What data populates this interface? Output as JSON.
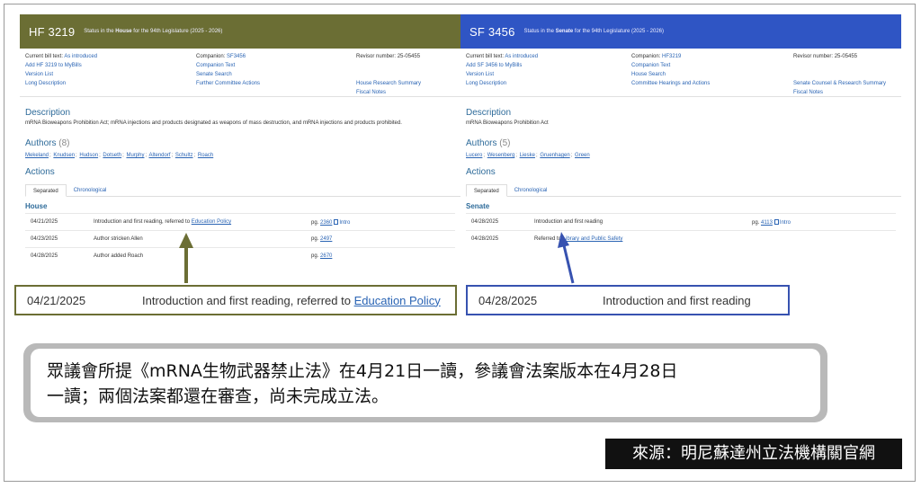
{
  "house": {
    "bill_number": "HF 3219",
    "status_pre": "Status in the ",
    "status_bold": "House",
    "status_post": " for the 94th Legislature (2025 - 2026)",
    "current_bill_text_label": "Current bill text:",
    "current_bill_text": "As introduced",
    "add_mybills": "Add HF 3219 to MyBills",
    "version_list": "Version List",
    "long_description": "Long Description",
    "companion_label": "Companion:",
    "companion": "SF3456",
    "companion_text": "Companion Text",
    "search_link": "Senate Search",
    "committee_link": "Further Committee Actions",
    "revisor_label": "Revisor number:",
    "revisor_number": "25-05455",
    "research_link": "House Research Summary",
    "fiscal_notes": "Fiscal Notes",
    "description_title": "Description",
    "description_text": "mRNA Bioweapons Prohibition Act; mRNA injections and products designated as weapons of mass destruction, and mRNA injections and products prohibited.",
    "authors_title": "Authors",
    "authors_count": "(8)",
    "authors": [
      "Mekeland",
      "Knudsen",
      "Hudson",
      "Dotseth",
      "Murphy",
      "Altendorf",
      "Schultz",
      "Roach"
    ],
    "actions_title": "Actions",
    "tab_separated": "Separated",
    "tab_chronological": "Chronological",
    "chamber": "House",
    "actions": [
      {
        "date": "04/21/2025",
        "text": "Introduction and first reading, referred to ",
        "link": "Education Policy",
        "pg_label": "pg.",
        "pg": "2360",
        "pdf": "Intro"
      },
      {
        "date": "04/23/2025",
        "text": "Author stricken Allen",
        "link": "",
        "pg_label": "pg.",
        "pg": "2497",
        "pdf": ""
      },
      {
        "date": "04/28/2025",
        "text": "Author added Roach",
        "link": "",
        "pg_label": "pg.",
        "pg": "2670",
        "pdf": ""
      }
    ]
  },
  "senate": {
    "bill_number": "SF 3456",
    "status_pre": "Status in the ",
    "status_bold": "Senate",
    "status_post": " for the 94th Legislature (2025 - 2026)",
    "current_bill_text_label": "Current bill text:",
    "current_bill_text": "As introduced",
    "add_mybills": "Add SF 3456 to MyBills",
    "version_list": "Version List",
    "long_description": "Long Description",
    "companion_label": "Companion:",
    "companion": "HF3219",
    "companion_text": "Companion Text",
    "search_link": "House Search",
    "committee_link": "Committee Hearings and Actions",
    "revisor_label": "Revisor number:",
    "revisor_number": "25-05455",
    "research_link": "Senate Counsel & Research Summary",
    "fiscal_notes": "Fiscal Notes",
    "description_title": "Description",
    "description_text": "mRNA Bioweapons Prohibition Act",
    "authors_title": "Authors",
    "authors_count": "(5)",
    "authors": [
      "Lucero",
      "Wesenberg",
      "Lieske",
      "Gruenhagen",
      "Green"
    ],
    "actions_title": "Actions",
    "tab_separated": "Separated",
    "tab_chronological": "Chronological",
    "chamber": "Senate",
    "actions": [
      {
        "date": "04/28/2025",
        "text": "Introduction and first reading",
        "link": "",
        "pg_label": "pg.",
        "pg": "4113",
        "pdf": "Intro"
      },
      {
        "date": "04/28/2025",
        "text": "Referred to ",
        "link": "Library and Public Safety",
        "pg_label": "",
        "pg": "",
        "pdf": ""
      }
    ]
  },
  "callouts": {
    "house": {
      "date": "04/21/2025",
      "text": "Introduction and first reading, referred to ",
      "link": "Education Policy"
    },
    "senate": {
      "date": "04/28/2025",
      "text": "Introduction and first reading"
    }
  },
  "summary": {
    "line1": "眾議會所提《mRNA生物武器禁止法》在4月21日一讀，參議會法案版本在4月28日",
    "line2": "一讀；兩個法案都還在審查，尚未完成立法。"
  },
  "source": "來源：明尼蘇達州立法機構關官網",
  "colors": {
    "house_header": "#6b6e34",
    "senate_header": "#2f55c4",
    "link": "#2a64b4",
    "section_title": "#2e6b9a"
  }
}
